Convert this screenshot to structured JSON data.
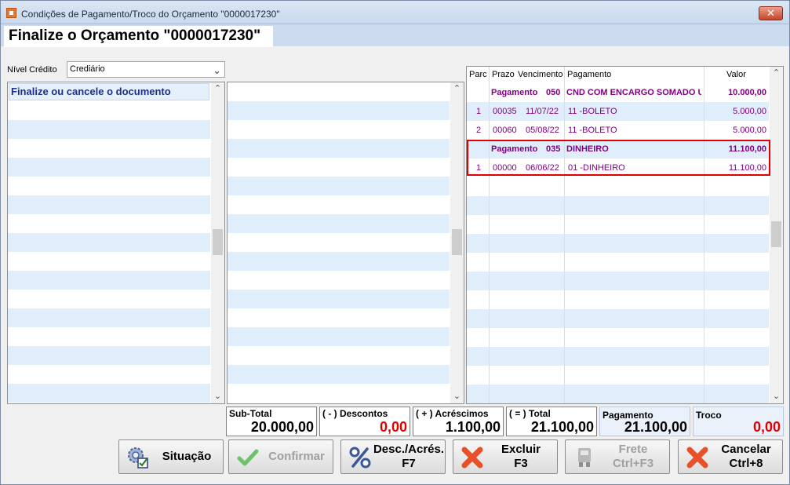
{
  "window": {
    "title": "Condições de Pagamento/Troco do Orçamento \"0000017230\"",
    "close_glyph": "✕"
  },
  "header": {
    "title": "Finalize o Orçamento \"0000017230\""
  },
  "nivel_credito": {
    "label": "Nível Crédito",
    "value": "Crediário"
  },
  "left_list": {
    "header": "Finalize ou cancele o documento"
  },
  "grid": {
    "columns": [
      "Parc",
      "Prazo",
      "Vencimento",
      "Pagamento",
      "Valor"
    ],
    "rows": [
      {
        "group": true,
        "parc": "",
        "prazo": "Pagamento",
        "venc": "050",
        "pagamento": "CND COM ENCARGO SOMADO ULT",
        "valor": "10.000,00"
      },
      {
        "group": false,
        "parc": "1",
        "prazo": "00035",
        "venc": "11/07/22",
        "pagamento": "11 -BOLETO",
        "valor": "5.000,00"
      },
      {
        "group": false,
        "parc": "2",
        "prazo": "00060",
        "venc": "05/08/22",
        "pagamento": "11 -BOLETO",
        "valor": "5.000,00"
      },
      {
        "group": true,
        "parc": "",
        "prazo": "Pagamento",
        "venc": "035",
        "pagamento": "DINHEIRO",
        "valor": "11.100,00"
      },
      {
        "group": false,
        "parc": "1",
        "prazo": "00000",
        "venc": "06/06/22",
        "pagamento": "01 -DINHEIRO",
        "valor": "11.100,00"
      }
    ]
  },
  "totals": {
    "subtotal": {
      "label": "Sub-Total",
      "value": "20.000,00"
    },
    "descontos": {
      "label": "( - ) Descontos",
      "value": "0,00"
    },
    "acrescimos": {
      "label": "( + ) Acréscimos",
      "value": "1.100,00"
    },
    "total": {
      "label": "( = ) Total",
      "value": "21.100,00"
    },
    "pagamento": {
      "label": "Pagamento",
      "value": "21.100,00"
    },
    "troco": {
      "label": "Troco",
      "value": "0,00"
    }
  },
  "buttons": {
    "situacao": {
      "label": "Situação"
    },
    "confirmar": {
      "label": "Confirmar"
    },
    "desc_acres": {
      "line1": "Desc./Acrés.",
      "line2": "F7"
    },
    "excluir": {
      "line1": "Excluir",
      "line2": "F3"
    },
    "frete": {
      "line1": "Frete",
      "line2": "Ctrl+F3"
    },
    "cancelar": {
      "line1": "Cancelar",
      "line2": "Ctrl+8"
    }
  },
  "colors": {
    "accent": "#800080",
    "alert": "#e00000",
    "row_alt": "#e0eefb",
    "header_band": "#ccdcee"
  }
}
